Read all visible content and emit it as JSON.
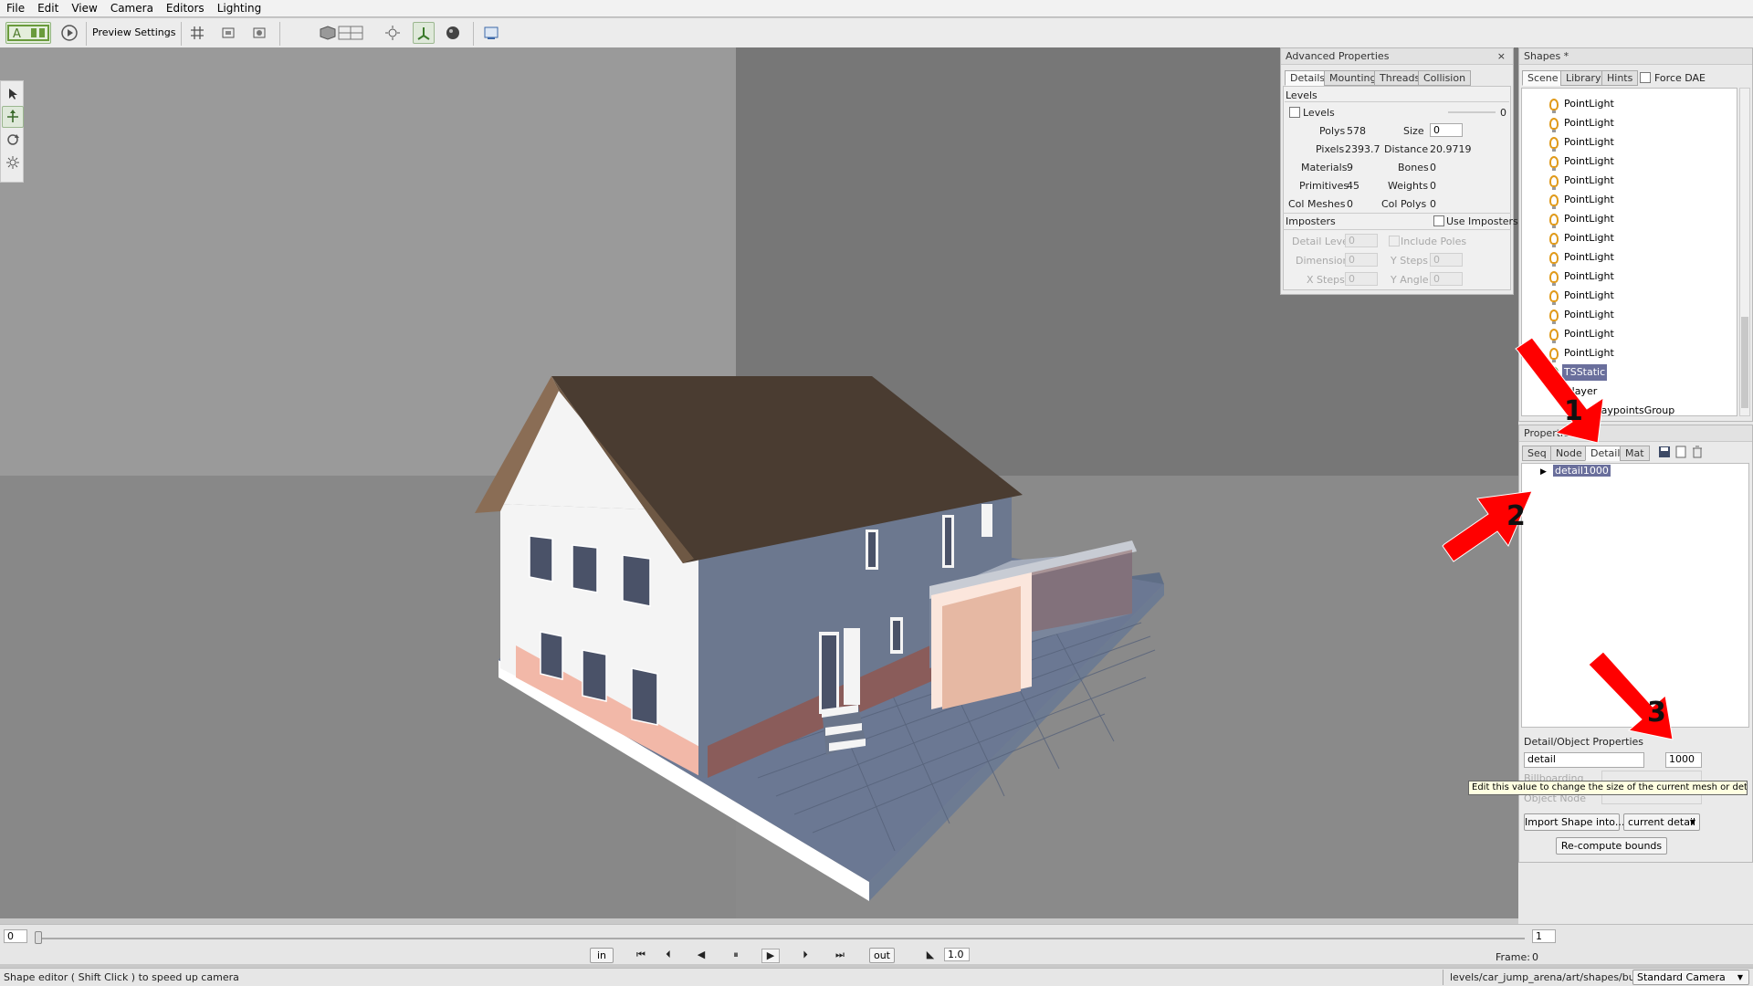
{
  "menu": [
    "File",
    "Edit",
    "View",
    "Camera",
    "Editors",
    "Lighting"
  ],
  "toolbar": {
    "preview_label": "Preview Settings"
  },
  "adv": {
    "title": "Advanced Properties",
    "tabs": [
      "Details",
      "Mounting",
      "Threads",
      "Collision"
    ],
    "levels_header": "Levels",
    "levels_cb": "Levels",
    "levels_val": "0",
    "polys_l": "Polys",
    "polys_v": "578",
    "size_l": "Size",
    "size_v": "0",
    "pixels_l": "Pixels",
    "pixels_v": "2393.7",
    "dist_l": "Distance",
    "dist_v": "20.9719",
    "mat_l": "Materials",
    "mat_v": "9",
    "bones_l": "Bones",
    "bones_v": "0",
    "prim_l": "Primitives",
    "prim_v": "45",
    "weights_l": "Weights",
    "weights_v": "0",
    "colm_l": "Col Meshes",
    "colm_v": "0",
    "colp_l": "Col Polys",
    "colp_v": "0",
    "imp_header": "Imposters",
    "use_imp": "Use Imposters",
    "dl_l": "Detail Level",
    "dl_v": "0",
    "incp": "Include Poles",
    "dim_l": "Dimension",
    "dim_v": "0",
    "ys_l": "Y Steps",
    "ys_v": "0",
    "xs_l": "X Steps",
    "xs_v": "0",
    "ya_l": "Y Angle",
    "ya_v": "0"
  },
  "shapes": {
    "title": "Shapes *",
    "tabs": [
      "Scene",
      "Library",
      "Hints"
    ],
    "force_dae": "Force DAE",
    "items": [
      "PointLight",
      "PointLight",
      "PointLight",
      "PointLight",
      "PointLight",
      "PointLight",
      "PointLight",
      "PointLight",
      "PointLight",
      "PointLight",
      "PointLight",
      "PointLight",
      "PointLight",
      "PointLight"
    ],
    "tsstatic": "TSStatic",
    "player": "Player",
    "waypoints": "LocalWaypointsGroup"
  },
  "props": {
    "title": "Properties",
    "tabs": [
      "Seq",
      "Node",
      "Detail",
      "Mat"
    ],
    "tree_item": "detail1000",
    "dop_header": "Detail/Object Properties",
    "detail_name": "detail",
    "detail_size": "1000",
    "billboard": "Billboarding",
    "objnode": "Object Node",
    "tooltip": "Edit this value to change the size of the current mesh or detail",
    "import_btn": "Import Shape into...",
    "current_detail": "current detail",
    "recompute": "Re-compute bounds"
  },
  "annotations": [
    "1",
    "2",
    "3"
  ],
  "timeline": {
    "start": "0",
    "end": "1",
    "in": "in",
    "out": "out",
    "speed": "1.0",
    "frame_label": "Frame:",
    "frame_val": "0"
  },
  "status": {
    "left": "Shape editor ( Shift Click ) to speed up camera",
    "path": "levels/car_jump_arena/art/shapes/bui",
    "camera": "Standard Camera"
  },
  "colors": {
    "accent_arrow": "#ff0000",
    "selection": "#6a6f9c",
    "bulb": "#e09a1a"
  }
}
